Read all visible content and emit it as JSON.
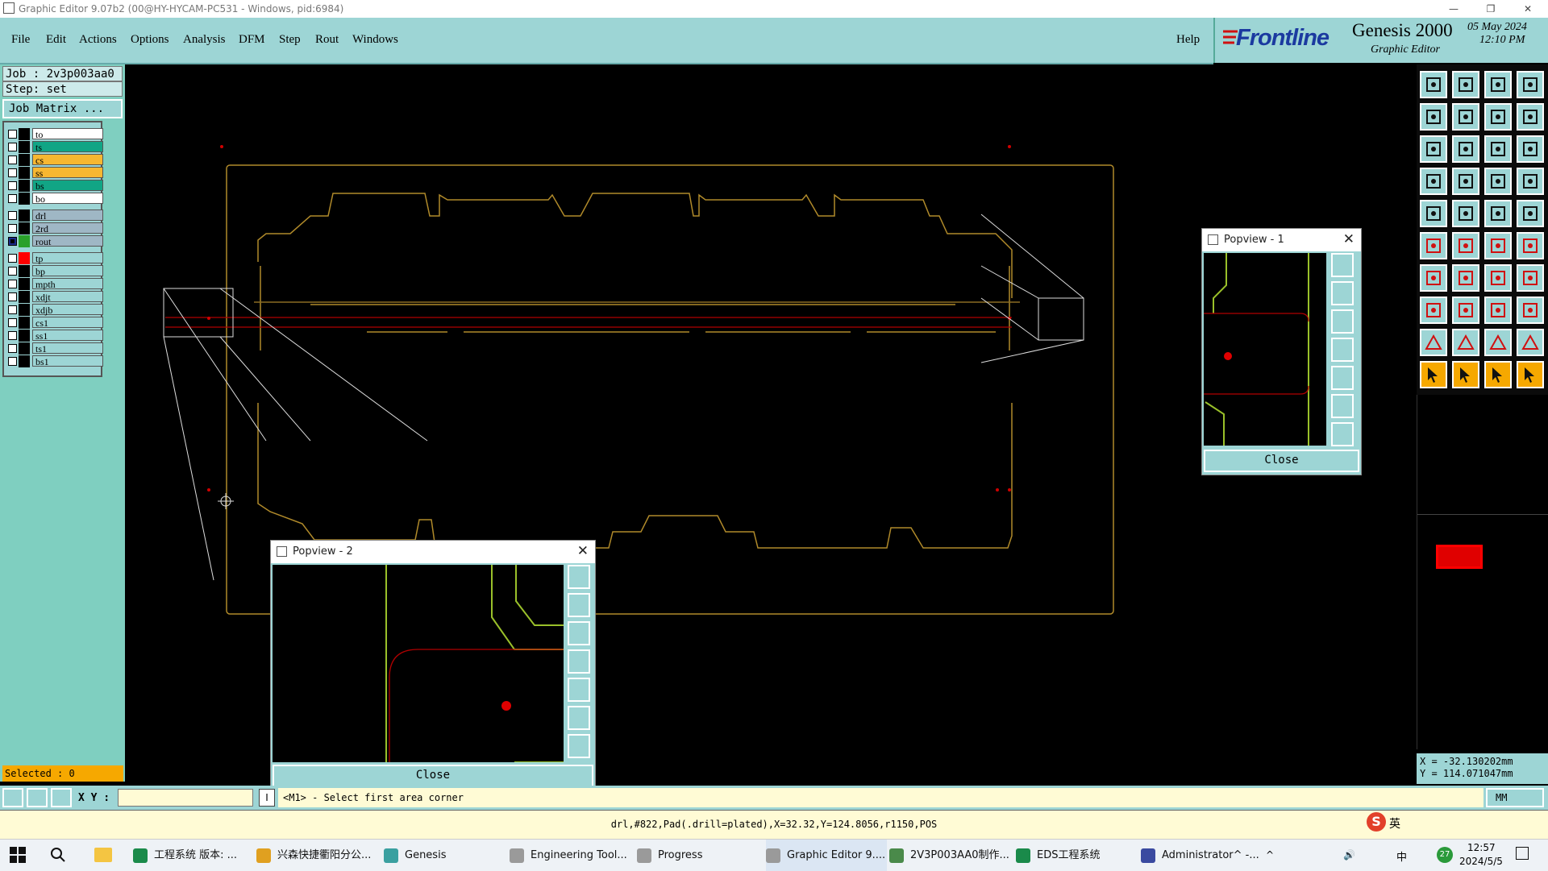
{
  "window": {
    "title": "Graphic Editor 9.07b2 (00@HY-HYCAM-PC531 - Windows, pid:6984)",
    "minimize_glyph": "—",
    "restore_glyph": "❐",
    "close_glyph": "✕"
  },
  "menu": {
    "items": [
      "File",
      "Edit",
      "Actions",
      "Options",
      "Analysis",
      "DFM",
      "Step",
      "Rout",
      "Windows"
    ],
    "help": "Help"
  },
  "brand": {
    "logo": "Frontline",
    "product": "Genesis 2000",
    "subtitle": "Graphic Editor",
    "date": "05 May 2024",
    "time": "12:10 PM"
  },
  "left_panel": {
    "job": "Job : 2v3p003aa0",
    "step": "Step: set",
    "job_matrix": "Job Matrix ...",
    "layers": [
      {
        "name": "to",
        "color": "#ffffff",
        "swatch": "#000000",
        "checked": false
      },
      {
        "name": "ts",
        "color": "#11a585",
        "swatch": "#000000",
        "checked": false
      },
      {
        "name": "cs",
        "color": "#f7b731",
        "swatch": "#000000",
        "checked": false
      },
      {
        "name": "ss",
        "color": "#f7b731",
        "swatch": "#000000",
        "checked": false
      },
      {
        "name": "bs",
        "color": "#11a585",
        "swatch": "#000000",
        "checked": false
      },
      {
        "name": "bo",
        "color": "#ffffff",
        "swatch": "#000000",
        "checked": false
      },
      {
        "name": "drl",
        "color": "#9fb7c5",
        "swatch": "#000000",
        "checked": false
      },
      {
        "name": "2rd",
        "color": "#9fb7c5",
        "swatch": "#000000",
        "checked": false
      },
      {
        "name": "rout",
        "color": "#9fb7c5",
        "swatch": "#2aa12a",
        "checked": true
      },
      {
        "name": "tp",
        "color": "#9dd5d5",
        "swatch": "#ff0000",
        "checked": false
      },
      {
        "name": "bp",
        "color": "#9dd5d5",
        "swatch": "#000000",
        "checked": false
      },
      {
        "name": "mpth",
        "color": "#9dd5d5",
        "swatch": "#000000",
        "checked": false
      },
      {
        "name": "xdjt",
        "color": "#9dd5d5",
        "swatch": "#000000",
        "checked": false
      },
      {
        "name": "xdjb",
        "color": "#9dd5d5",
        "swatch": "#000000",
        "checked": false
      },
      {
        "name": "cs1",
        "color": "#9dd5d5",
        "swatch": "#000000",
        "checked": false
      },
      {
        "name": "ss1",
        "color": "#9dd5d5",
        "swatch": "#000000",
        "checked": false
      },
      {
        "name": "ts1",
        "color": "#9dd5d5",
        "swatch": "#000000",
        "checked": false
      },
      {
        "name": "bs1",
        "color": "#9dd5d5",
        "swatch": "#000000",
        "checked": false
      }
    ],
    "selected": "Selected : 0"
  },
  "popview1": {
    "title": "Popview - 1",
    "close_label": "Close"
  },
  "popview2": {
    "title": "Popview - 2",
    "close_label": "Close"
  },
  "coords": {
    "x": "X = -32.130202mm",
    "y": "Y = 114.071047mm"
  },
  "command_bar": {
    "xy_label": "X Y :",
    "xy_value": "",
    "prompt": "<M1> - Select first area corner",
    "units": "MM"
  },
  "status_line": "drl,#822,Pad(.drill=plated),X=32.32,Y=124.8056,r1150,POS",
  "taskbar": {
    "items": [
      {
        "label": "工程系统  版本: ...",
        "color": "#1a8a4a"
      },
      {
        "label": "兴森快捷衢阳分公...",
        "color": "#e0a020"
      },
      {
        "label": "Genesis",
        "color": "#3aa0a0"
      },
      {
        "label": "Engineering Tool...",
        "color": "#9a9a9a"
      },
      {
        "label": "Progress",
        "color": "#9a9a9a"
      },
      {
        "label": "Graphic Editor 9....",
        "color": "#9a9a9a"
      },
      {
        "label": "2V3P003AA0制作...",
        "color": "#4a8a4a"
      },
      {
        "label": "EDS工程系统",
        "color": "#1a8a4a"
      },
      {
        "label": "Administrator^ -...",
        "color": "#3a4aa0"
      }
    ],
    "tray_lang": "中",
    "tray_temp": "27",
    "clock_time": "12:57",
    "clock_date": "2024/5/5",
    "ime": "英"
  }
}
